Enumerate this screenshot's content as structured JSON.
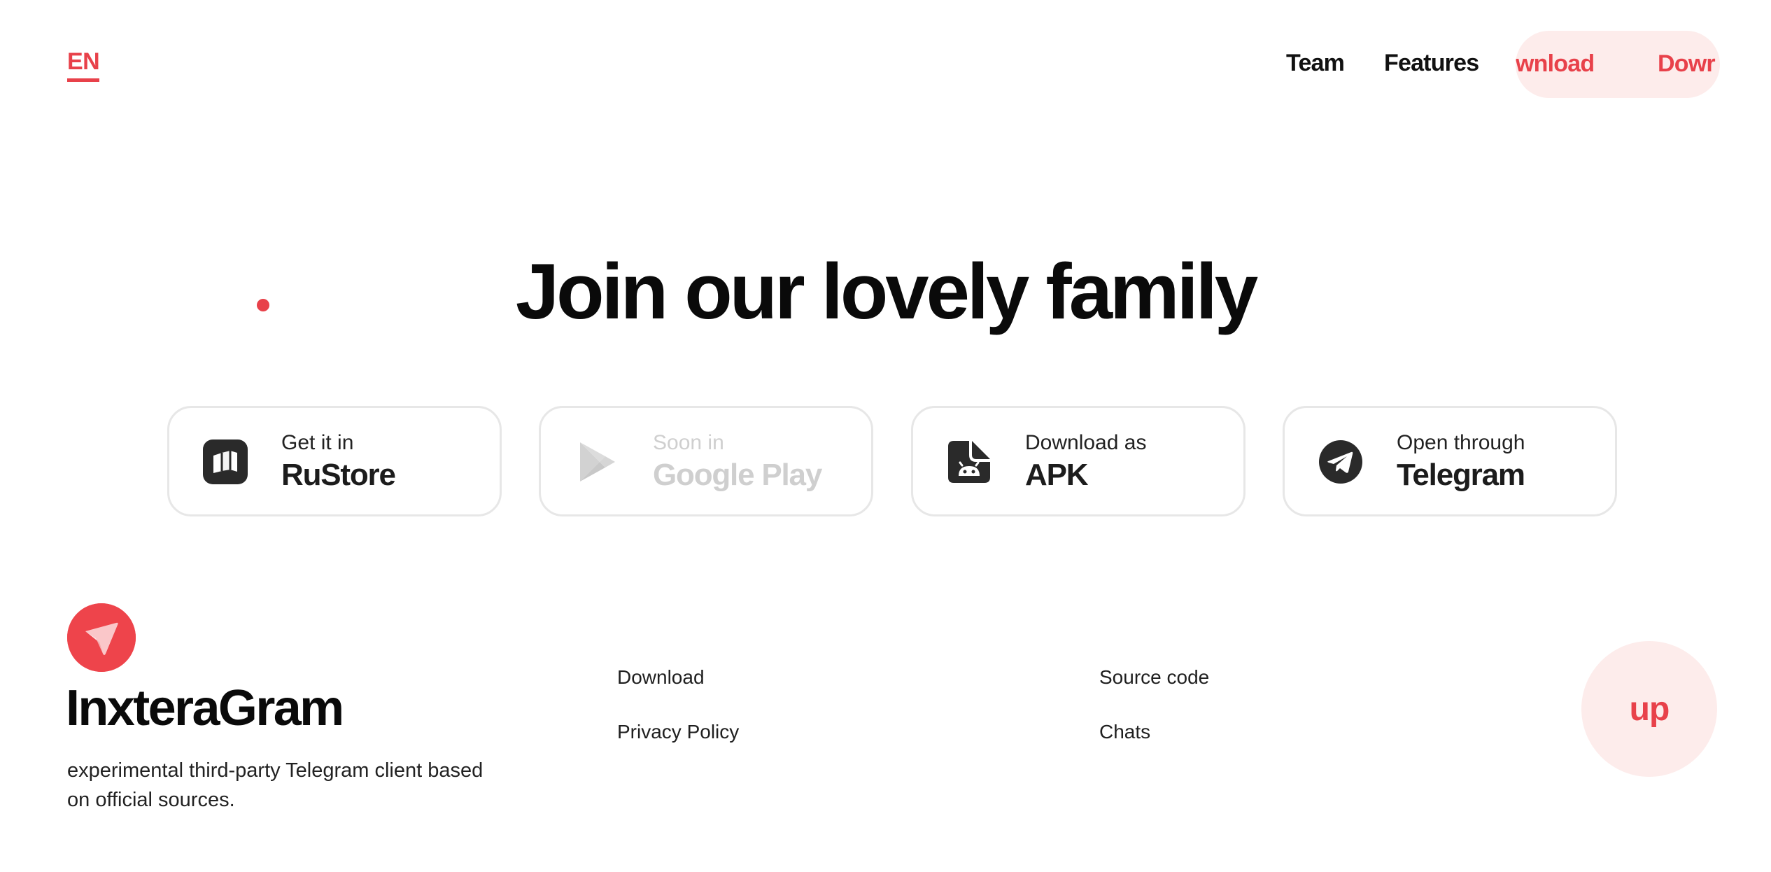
{
  "header": {
    "language": "EN",
    "nav": {
      "team": "Team",
      "features": "Features"
    },
    "download_marquee": [
      "wnload",
      "Dowr"
    ]
  },
  "hero": {
    "title": "Join our lovely family"
  },
  "stores": [
    {
      "small": "Get it in",
      "big": "RuStore",
      "icon": "rustore-icon",
      "enabled": true
    },
    {
      "small": "Soon in",
      "big": "Google Play",
      "icon": "google-play-icon",
      "enabled": false
    },
    {
      "small": "Download as",
      "big": "APK",
      "icon": "android-apk-icon",
      "enabled": true
    },
    {
      "small": "Open through",
      "big": "Telegram",
      "icon": "telegram-icon",
      "enabled": true
    }
  ],
  "footer": {
    "brand": "InxteraGram",
    "tagline": "experimental third-party Telegram client based on official sources.",
    "links": {
      "download": "Download",
      "privacy": "Privacy Policy",
      "source": "Source code",
      "chats": "Chats"
    },
    "up_label": "up"
  },
  "colors": {
    "accent": "#e8414a",
    "accent_soft": "#fdeceb",
    "text": "#111111",
    "disabled": "#cfcfcf",
    "card_border": "#e7e7e7"
  }
}
